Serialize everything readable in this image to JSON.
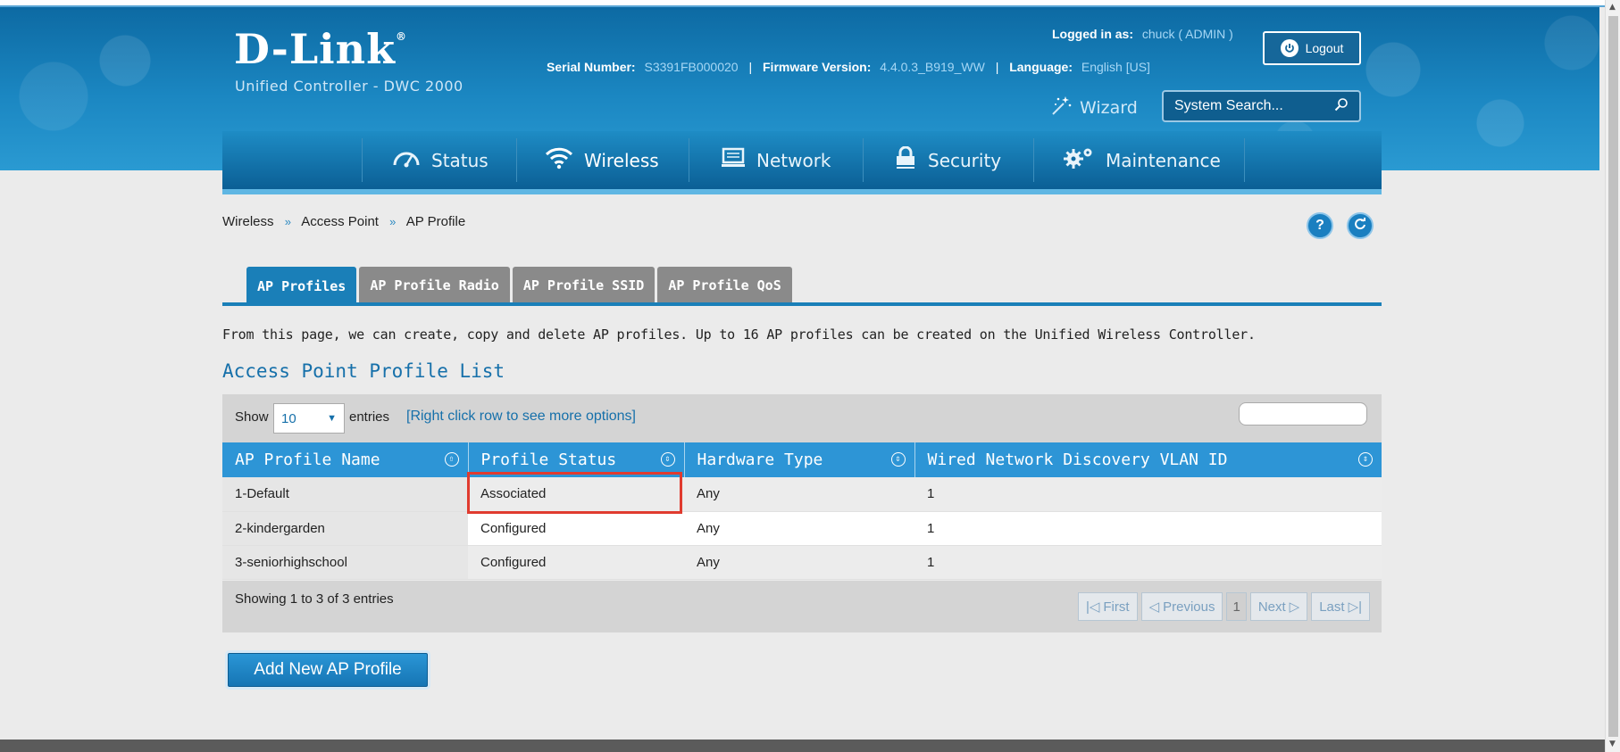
{
  "brand": {
    "logo": "D-Link",
    "reg": "®",
    "subtitle": "Unified Controller - DWC 2000"
  },
  "header": {
    "logged_in_label": "Logged in as:",
    "user": "chuck ( ADMIN )",
    "logout_label": "Logout",
    "serial_label": "Serial Number:",
    "serial_value": "S3391FB000020",
    "firmware_label": "Firmware Version:",
    "firmware_value": "4.4.0.3_B919_WW",
    "language_label": "Language:",
    "language_value": "English [US]",
    "wizard_label": "Wizard",
    "search_placeholder": "System Search..."
  },
  "nav": {
    "items": [
      {
        "label": "Status",
        "icon": "gauge-icon"
      },
      {
        "label": "Wireless",
        "icon": "wifi-icon",
        "active": true
      },
      {
        "label": "Network",
        "icon": "monitor-icon"
      },
      {
        "label": "Security",
        "icon": "lock-icon"
      },
      {
        "label": "Maintenance",
        "icon": "gears-icon"
      }
    ]
  },
  "breadcrumb": {
    "items": [
      "Wireless",
      "Access Point",
      "AP Profile"
    ],
    "separator": "»"
  },
  "tabs": [
    "AP Profiles",
    "AP Profile Radio",
    "AP Profile SSID",
    "AP Profile QoS"
  ],
  "description": "From this page, we can create, copy and delete AP profiles. Up to 16 AP profiles can be created on the Unified Wireless Controller.",
  "section_title": "Access Point Profile List",
  "toolbar": {
    "show_label": "Show",
    "entries_value": "10",
    "entries_label": "entries",
    "hint": "[Right click row to see more options]"
  },
  "table": {
    "columns": [
      "AP Profile Name",
      "Profile Status",
      "Hardware Type",
      "Wired Network Discovery VLAN ID"
    ],
    "rows": [
      [
        "1-Default",
        "Associated",
        "Any",
        "1"
      ],
      [
        "2-kindergarden",
        "Configured",
        "Any",
        "1"
      ],
      [
        "3-seniorhighschool",
        "Configured",
        "Any",
        "1"
      ]
    ]
  },
  "footer": {
    "info": "Showing 1 to 3 of 3 entries",
    "first": "First",
    "previous": "Previous",
    "page": "1",
    "next": "Next",
    "last": "Last"
  },
  "add_button": "Add New AP Profile",
  "colors": {
    "accent": "#1a7fb8",
    "highlight": "#e03b2f",
    "header_blue": "#0d6aa3"
  }
}
